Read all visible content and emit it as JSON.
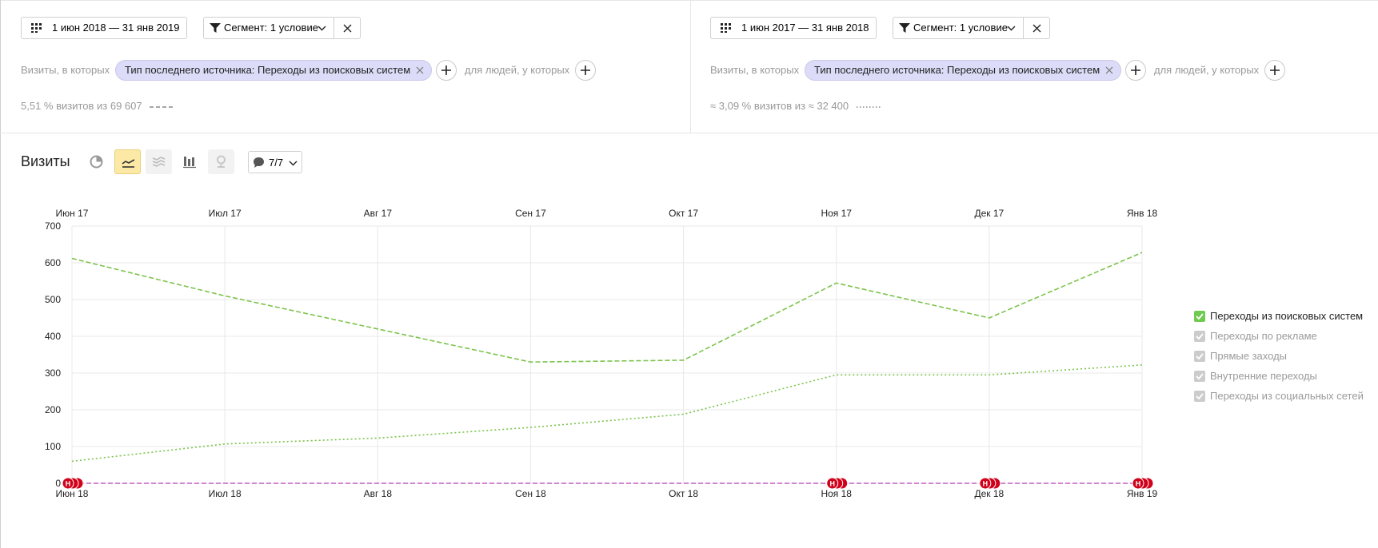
{
  "colors": {
    "search_series": "#7cc44c",
    "other_series": "#c45fc4",
    "note_marker": "#d0021b",
    "active_tool": "#fde9a6"
  },
  "segments": [
    {
      "date_range": "1 июн 2018 — 31 янв 2019",
      "segment_label": "Сегмент: 1 условие",
      "visits_prefix": "Визиты, в которых",
      "condition_tag": "Тип последнего источника: Переходы из поисковых систем",
      "people_prefix": "для людей, у которых",
      "share": "5,51 % визитов из 69 607",
      "line_style": "dashed"
    },
    {
      "date_range": "1 июн 2017 — 31 янв 2018",
      "segment_label": "Сегмент: 1 условие",
      "visits_prefix": "Визиты, в которых",
      "condition_tag": "Тип последнего источника: Переходы из поисковых систем",
      "people_prefix": "для людей, у которых",
      "share": "≈ 3,09 % визитов из ≈ 32 400",
      "line_style": "dotted"
    }
  ],
  "report": {
    "title": "Визиты",
    "tools": [
      "pie-chart-icon",
      "line-chart-icon",
      "area-chart-icon",
      "bar-chart-icon",
      "map-pin-icon"
    ],
    "active_tool": "line-chart-icon",
    "notes_count": "7/7"
  },
  "chart_data": {
    "type": "line",
    "x_top": [
      "Июн 17",
      "Июл 17",
      "Авг 17",
      "Сен 17",
      "Окт 17",
      "Ноя 17",
      "Дек 17",
      "Янв 18"
    ],
    "x_bottom": [
      "Июн 18",
      "Июл 18",
      "Авг 18",
      "Сен 18",
      "Окт 18",
      "Ноя 18",
      "Дек 18",
      "Янв 19"
    ],
    "y_ticks": [
      0,
      100,
      200,
      300,
      400,
      500,
      600,
      700
    ],
    "ylim": [
      0,
      700
    ],
    "grid": true,
    "legend_position": "right",
    "series": [
      {
        "name": "Переходы из поисковых систем",
        "period": "1 июн 2018 — 31 янв 2019",
        "style": "dashed",
        "values": [
          612,
          510,
          420,
          330,
          335,
          545,
          450,
          628
        ]
      },
      {
        "name": "Переходы из поисковых систем",
        "period": "1 июн 2017 — 31 янв 2018",
        "style": "dotted",
        "values": [
          60,
          107,
          123,
          152,
          188,
          295,
          295,
          322
        ]
      },
      {
        "name": "Переходы по рекламе",
        "style": "dashed",
        "values": [
          0,
          0,
          0,
          0,
          0,
          0,
          0,
          0
        ]
      }
    ],
    "note_markers": [
      {
        "at": "Июн 18",
        "label": "Н"
      },
      {
        "at": "Ноя 18",
        "label": "Н"
      },
      {
        "at": "Дек 18",
        "label": "Н"
      },
      {
        "at": "Янв 19",
        "label": "Н"
      }
    ]
  },
  "legend": [
    {
      "label": "Переходы из поисковых систем",
      "enabled": true
    },
    {
      "label": "Переходы по рекламе",
      "enabled": false
    },
    {
      "label": "Прямые заходы",
      "enabled": false
    },
    {
      "label": "Внутренние переходы",
      "enabled": false
    },
    {
      "label": "Переходы из социальных сетей",
      "enabled": false
    }
  ]
}
